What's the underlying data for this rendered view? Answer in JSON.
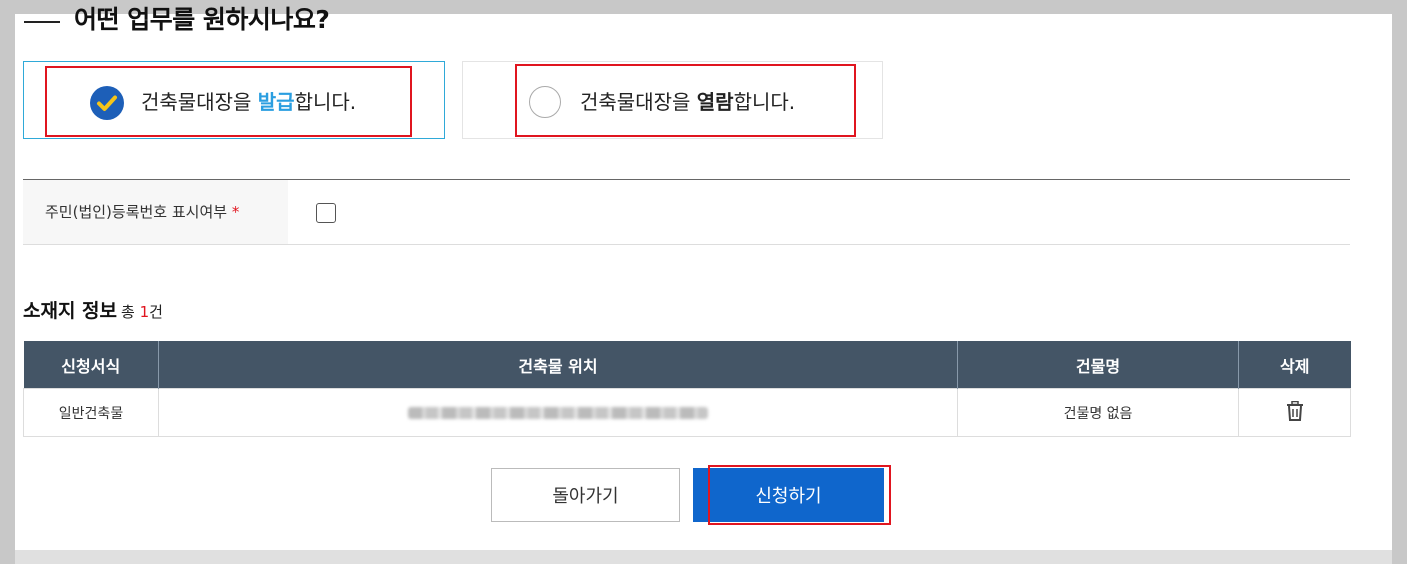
{
  "heading": "어떤 업무를 원하시나요?",
  "options": {
    "issue": {
      "prefix": "건축물대장을 ",
      "highlight": "발급",
      "suffix": "합니다.",
      "selected": true
    },
    "view": {
      "prefix": "건축물대장을 ",
      "highlight": "열람",
      "suffix": "합니다.",
      "selected": false
    }
  },
  "id_display": {
    "label": "주민(법인)등록번호 표시여부",
    "required_mark": "*",
    "checked": false
  },
  "section": {
    "title": "소재지 정보",
    "count_prefix": "총 ",
    "count": "1",
    "count_suffix": "건"
  },
  "table": {
    "headers": [
      "신청서식",
      "건축물 위치",
      "건물명",
      "삭제"
    ],
    "rows": [
      {
        "form": "일반건축물",
        "location": "",
        "building_name": "건물명 없음",
        "delete_icon": "trash-icon"
      }
    ]
  },
  "buttons": {
    "back": "돌아가기",
    "apply": "신청하기"
  },
  "colors": {
    "header_bg": "#445566",
    "primary": "#0f66cc",
    "highlight": "#e0151f",
    "accent_blue": "#2a9ee0"
  }
}
